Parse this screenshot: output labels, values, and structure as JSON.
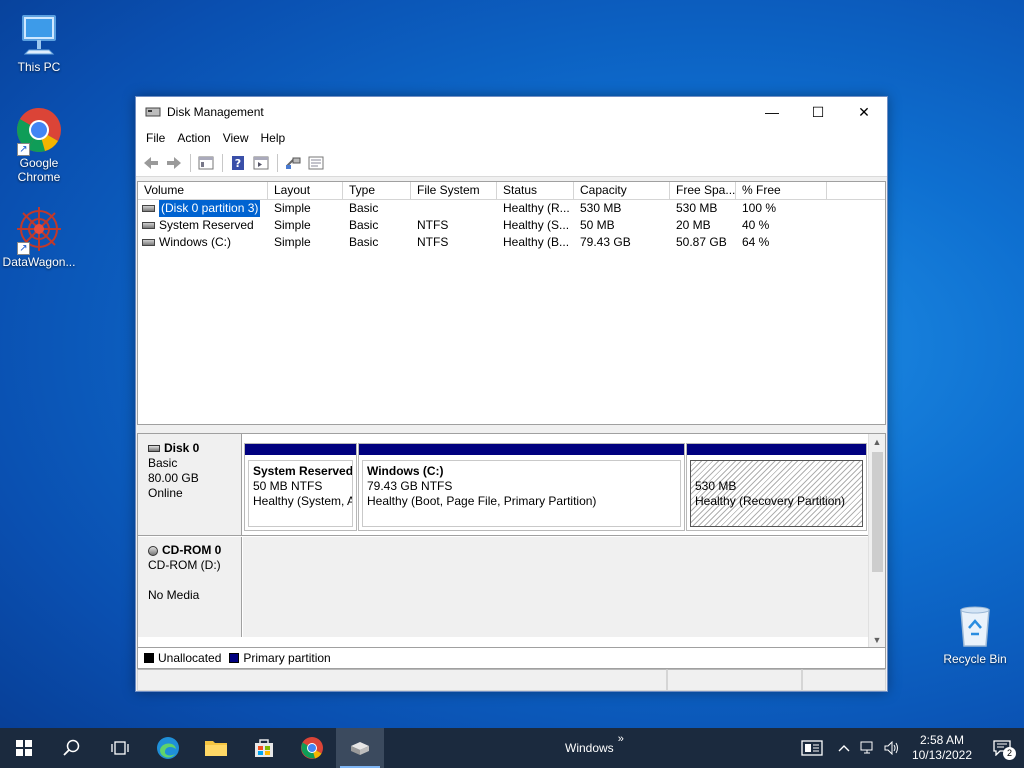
{
  "desktop": {
    "icons": [
      {
        "label": "This PC"
      },
      {
        "label": "Google Chrome"
      },
      {
        "label": "DataWagon..."
      },
      {
        "label": "Recycle Bin"
      }
    ]
  },
  "window": {
    "title": "Disk Management",
    "caption": {
      "minimize": "—",
      "maximize": "☐",
      "close": "✕"
    },
    "menu": [
      "File",
      "Action",
      "View",
      "Help"
    ],
    "toolbar_icons": [
      "back-arrow-icon",
      "forward-arrow-icon",
      "console-tree-icon",
      "help-icon",
      "action-pane-icon",
      "connect-icon",
      "properties-icon"
    ]
  },
  "volume_list": {
    "columns": [
      "Volume",
      "Layout",
      "Type",
      "File System",
      "Status",
      "Capacity",
      "Free Spa...",
      "% Free"
    ],
    "rows": [
      {
        "volume": "(Disk 0 partition 3)",
        "layout": "Simple",
        "type": "Basic",
        "fs": "",
        "status": "Healthy (R...",
        "capacity": "530 MB",
        "free": "530 MB",
        "pct": "100 %"
      },
      {
        "volume": "System Reserved",
        "layout": "Simple",
        "type": "Basic",
        "fs": "NTFS",
        "status": "Healthy (S...",
        "capacity": "50 MB",
        "free": "20 MB",
        "pct": "40 %"
      },
      {
        "volume": "Windows (C:)",
        "layout": "Simple",
        "type": "Basic",
        "fs": "NTFS",
        "status": "Healthy (B...",
        "capacity": "79.43 GB",
        "free": "50.87 GB",
        "pct": "64 %"
      }
    ]
  },
  "disks": {
    "disk0": {
      "name": "Disk 0",
      "type": "Basic",
      "size": "80.00 GB",
      "state": "Online",
      "partitions": [
        {
          "name": "System Reserved",
          "size": "50 MB NTFS",
          "status": "Healthy (System, A"
        },
        {
          "name": "Windows  (C:)",
          "size": "79.43 GB NTFS",
          "status": "Healthy (Boot, Page File, Primary Partition)"
        },
        {
          "name": "",
          "size": "530 MB",
          "status": "Healthy (Recovery Partition)"
        }
      ]
    },
    "cdrom0": {
      "name": "CD-ROM 0",
      "drive": "CD-ROM (D:)",
      "media": "No Media"
    }
  },
  "legend": {
    "unallocated": "Unallocated",
    "primary": "Primary partition",
    "unallocated_color": "#000000",
    "primary_color": "#00007f"
  },
  "taskbar": {
    "search_label": "Windows",
    "time": "2:58 AM",
    "date": "10/13/2022",
    "notification_count": "2"
  }
}
